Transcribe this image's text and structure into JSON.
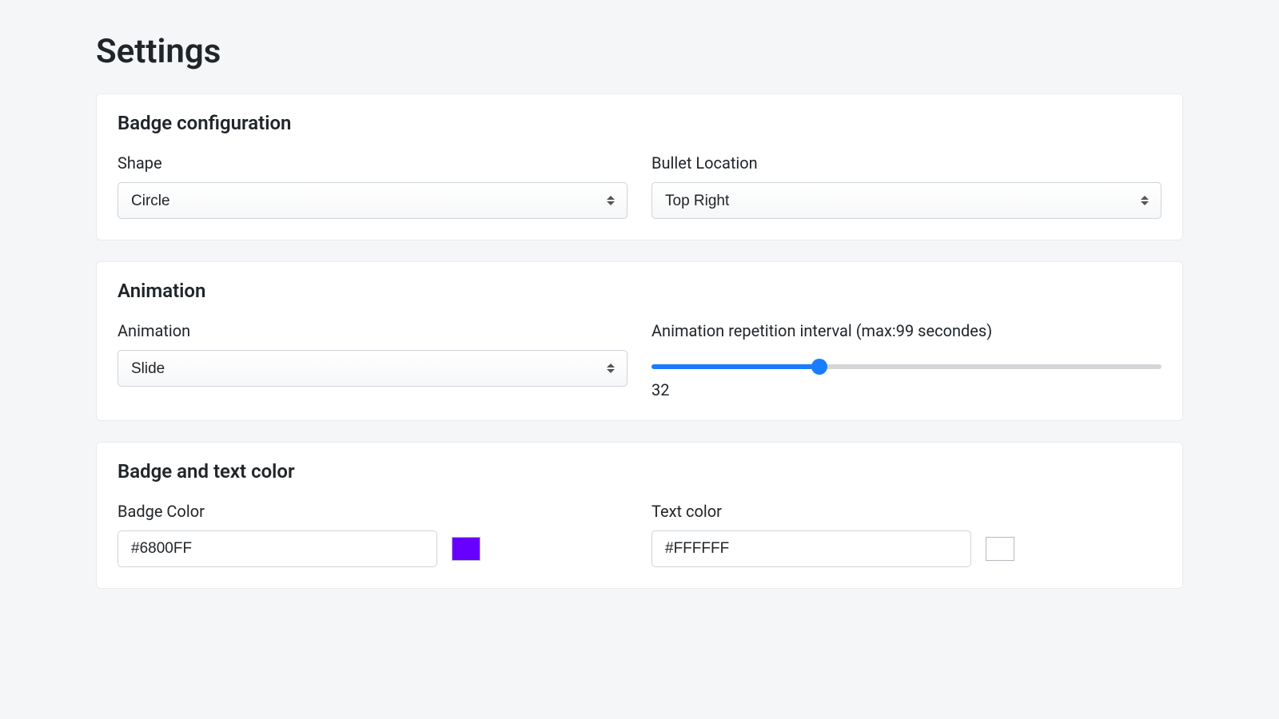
{
  "page": {
    "title": "Settings"
  },
  "badge_config": {
    "section_title": "Badge configuration",
    "shape": {
      "label": "Shape",
      "value": "Circle"
    },
    "bullet_location": {
      "label": "Bullet Location",
      "value": "Top Right"
    }
  },
  "animation": {
    "section_title": "Animation",
    "type": {
      "label": "Animation",
      "value": "Slide"
    },
    "interval": {
      "label": "Animation repetition interval (max:99 secondes)",
      "value": "32",
      "min": "0",
      "max": "99"
    }
  },
  "color": {
    "section_title": "Badge and text color",
    "badge": {
      "label": "Badge Color",
      "value": "#6800FF"
    },
    "text": {
      "label": "Text color",
      "value": "#FFFFFF"
    }
  }
}
